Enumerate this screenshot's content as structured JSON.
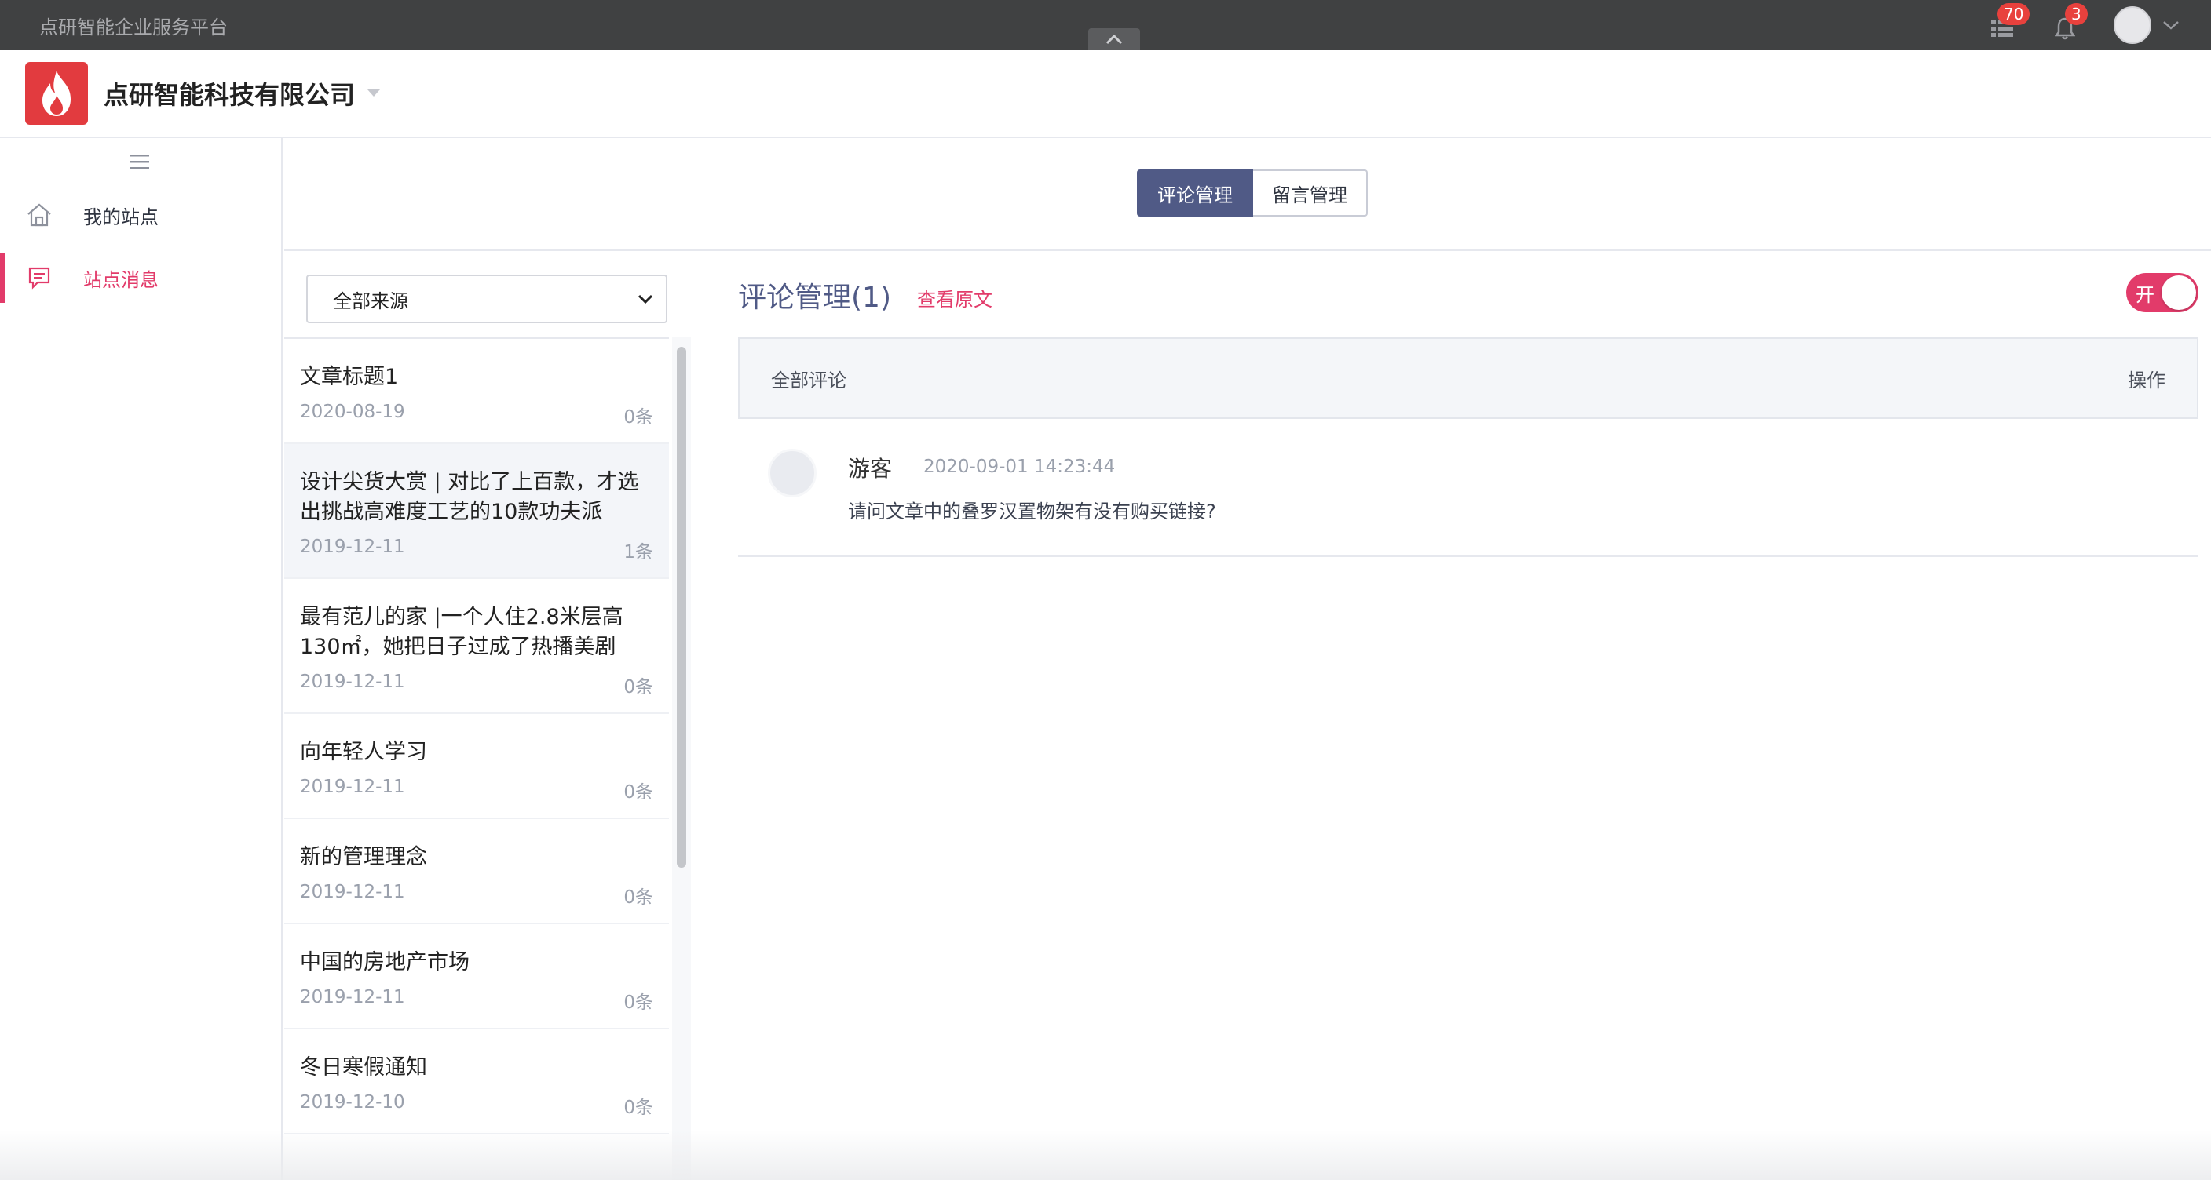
{
  "topbar": {
    "title": "点研智能企业服务平台",
    "grid_badge": "70",
    "bell_badge": "3",
    "icons": [
      "collapse-up-icon",
      "grid-icon",
      "bell-icon",
      "user-avatar",
      "chevron-down-icon"
    ]
  },
  "header": {
    "company_name": "点研智能科技有限公司",
    "logo_icon": "flame-icon"
  },
  "sidebar": {
    "items": [
      {
        "label": "我的站点",
        "icon": "home-icon",
        "active": false
      },
      {
        "label": "站点消息",
        "icon": "message-icon",
        "active": true
      }
    ]
  },
  "tabs": [
    {
      "label": "评论管理",
      "active": true
    },
    {
      "label": "留言管理",
      "active": false
    }
  ],
  "filter": {
    "selected": "全部来源"
  },
  "articles": [
    {
      "title": "文章标题1",
      "date": "2020-08-19",
      "count": "0条"
    },
    {
      "title": "设计尖货大赏 | 对比了上百款，才选出挑战高难度工艺的10款功夫派",
      "date": "2019-12-11",
      "count": "1条",
      "selected": true
    },
    {
      "title": "最有范儿的家 |一个人住2.8米层高130㎡，她把日子过成了热播美剧",
      "date": "2019-12-11",
      "count": "0条"
    },
    {
      "title": "向年轻人学习",
      "date": "2019-12-11",
      "count": "0条"
    },
    {
      "title": "新的管理理念",
      "date": "2019-12-11",
      "count": "0条"
    },
    {
      "title": "中国的房地产市场",
      "date": "2019-12-11",
      "count": "0条"
    },
    {
      "title": "冬日寒假通知",
      "date": "2019-12-10",
      "count": "0条"
    }
  ],
  "comments_panel": {
    "title": "评论管理(1)",
    "view_original": "查看原文",
    "toggle_label": "开",
    "toggle_on": true,
    "header_left": "全部评论",
    "header_right": "操作",
    "items": [
      {
        "author": "游客",
        "time": "2020-09-01 14:23:44",
        "text": "请问文章中的叠罗汉置物架有没有购买链接?"
      }
    ]
  },
  "colors": {
    "topbar_bg": "#404142",
    "accent_pink": "#e23b6a",
    "tab_active": "#505a86",
    "badge_red": "#e8413d",
    "logo_red": "#e23b3f"
  }
}
